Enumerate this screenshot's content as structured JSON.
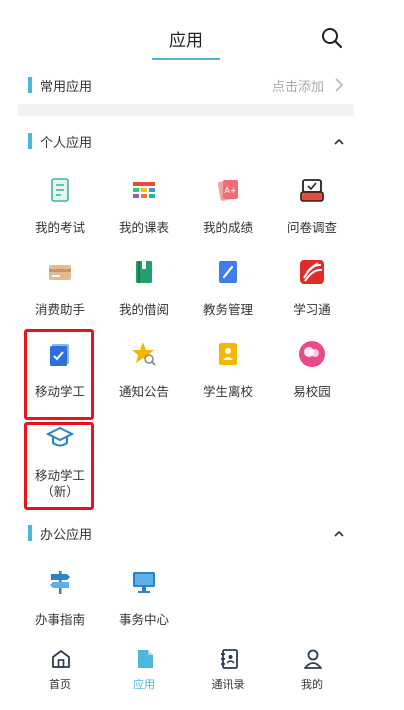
{
  "header": {
    "title": "应用"
  },
  "common": {
    "title": "常用应用",
    "action": "点击添加"
  },
  "personal": {
    "title": "个人应用",
    "items": [
      {
        "label": "我的考试"
      },
      {
        "label": "我的课表"
      },
      {
        "label": "我的成绩"
      },
      {
        "label": "问卷调查"
      },
      {
        "label": "消费助手"
      },
      {
        "label": "我的借阅"
      },
      {
        "label": "教务管理"
      },
      {
        "label": "学习通"
      },
      {
        "label": "移动学工"
      },
      {
        "label": "通知公告"
      },
      {
        "label": "学生离校"
      },
      {
        "label": "易校园"
      },
      {
        "label": "移动学工（新）"
      }
    ]
  },
  "office": {
    "title": "办公应用",
    "items": [
      {
        "label": "办事指南"
      },
      {
        "label": "事务中心"
      }
    ]
  },
  "tabbar": {
    "items": [
      {
        "label": "首页"
      },
      {
        "label": "应用"
      },
      {
        "label": "通讯录"
      },
      {
        "label": "我的"
      }
    ]
  },
  "colors": {
    "accent": "#4fb6d8",
    "highlight": "#e8131b"
  }
}
